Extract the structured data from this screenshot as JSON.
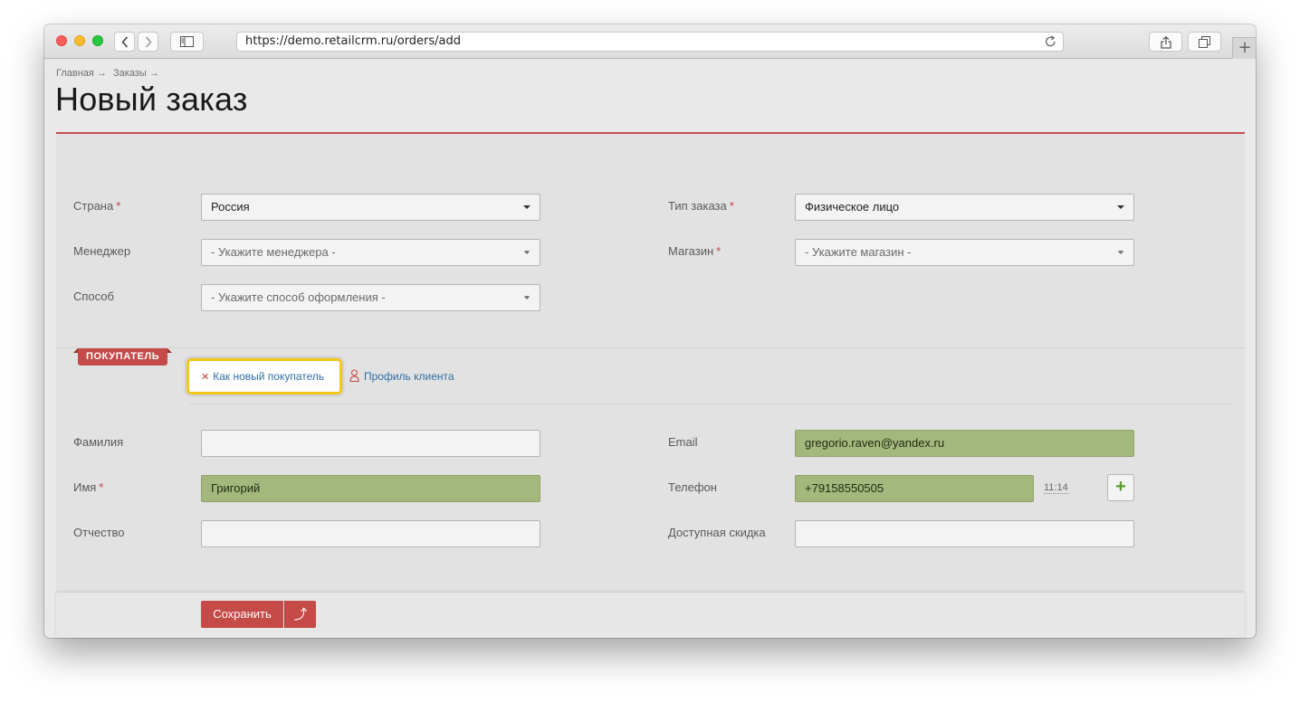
{
  "browser": {
    "url": "https://demo.retailcrm.ru/orders/add",
    "new_tab_label": "+"
  },
  "breadcrumb": [
    "Главная →",
    "Заказы →"
  ],
  "page_title": "Новый заказ",
  "order_fields": {
    "country": {
      "label": "Страна",
      "value": "Россия"
    },
    "manager": {
      "label": "Менеджер",
      "value": "- Укажите менеджера -"
    },
    "method": {
      "label": "Способ",
      "value": "- Укажите способ оформления -"
    },
    "order_type": {
      "label": "Тип заказа",
      "value": "Физическое лицо"
    },
    "shop": {
      "label": "Магазин",
      "value": "- Укажите магазин -"
    }
  },
  "customer_section": {
    "tag": "ПОКУПАТЕЛЬ",
    "new_customer_link": "Как новый покупатель",
    "profile_link": "Профиль клиента"
  },
  "customer_fields": {
    "last_name": {
      "label": "Фамилия",
      "value": ""
    },
    "first_name": {
      "label": "Имя",
      "value": "Григорий"
    },
    "middle_name": {
      "label": "Отчество",
      "value": ""
    },
    "email": {
      "label": "Email",
      "value": "gregorio.raven@yandex.ru"
    },
    "phone": {
      "label": "Телефон",
      "value": "+79158550505",
      "time": "11:14"
    },
    "discount": {
      "label": "Доступная скидка",
      "value": ""
    }
  },
  "footer": {
    "save_label": "Сохранить",
    "more_icon": "⤴"
  },
  "colors": {
    "accent": "#c44b48",
    "highlight": "#f2c81b",
    "autofill": "#a4b87d",
    "link": "#2f6ea8"
  }
}
